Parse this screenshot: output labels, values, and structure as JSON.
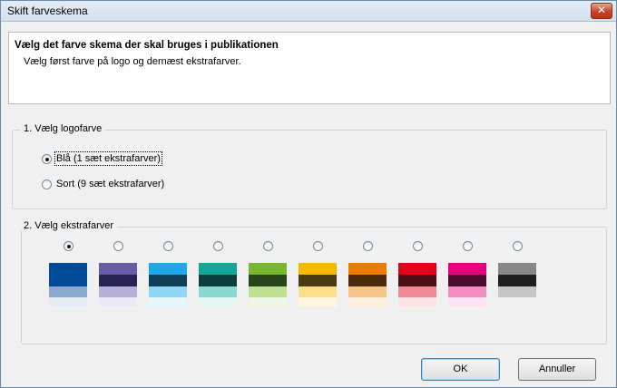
{
  "window": {
    "title": "Skift farveskema",
    "close_label": "✕"
  },
  "header": {
    "title": "Vælg det farve skema der skal bruges i publikationen",
    "subtitle": "Vælg først farve på logo og dernæst ekstrafarver."
  },
  "logo_group": {
    "legend": "1. Vælg logofarve",
    "options": [
      {
        "label": "Blå (1 sæt ekstrafarver)",
        "checked": true
      },
      {
        "label": "Sort (9 sæt ekstrafarver)",
        "checked": false
      }
    ]
  },
  "extra_group": {
    "legend": "2. Vælg ekstrafarver",
    "selected_index": 0,
    "swatches": [
      {
        "colors": [
          "#004b97",
          "#004b97",
          "#8ba9cc",
          "#e4ebf4"
        ]
      },
      {
        "colors": [
          "#6a5ba6",
          "#2a2358",
          "#b6b0d9",
          "#ebe9f5"
        ]
      },
      {
        "colors": [
          "#1ea8e6",
          "#0f3f55",
          "#8ed7f5",
          "#e5f6fd"
        ]
      },
      {
        "colors": [
          "#12a99a",
          "#0d3d3b",
          "#88d8cf",
          "#e2f6f4"
        ]
      },
      {
        "colors": [
          "#7ab730",
          "#26461a",
          "#bfe092",
          "#eef7e3"
        ]
      },
      {
        "colors": [
          "#f7b800",
          "#4a3a12",
          "#fbdf8c",
          "#fff6dd"
        ]
      },
      {
        "colors": [
          "#ec7b00",
          "#4c2a0c",
          "#f7c48a",
          "#fdeedd"
        ]
      },
      {
        "colors": [
          "#e2001a",
          "#4c0f14",
          "#f28a95",
          "#fde2e4"
        ]
      },
      {
        "colors": [
          "#e4007d",
          "#490a2b",
          "#f28dc1",
          "#fde3f1"
        ]
      },
      {
        "colors": [
          "#878787",
          "#1f1f1f",
          "#c6c6c6",
          "#f0f0f0"
        ]
      }
    ]
  },
  "buttons": {
    "ok": "OK",
    "cancel": "Annuller"
  }
}
